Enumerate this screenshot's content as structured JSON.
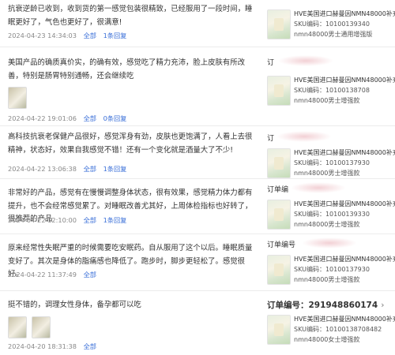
{
  "reviews": [
    {
      "text": "抗衰逆龄已收到，收到货的第一感觉包装很精致，已经服用了一段时间，睡眠更好了，气色也更好了，很满意!",
      "date": "2024-04-23 14:34:03",
      "link_all": "全部",
      "link_reply": "1条回复",
      "order_prefix": "",
      "product": {
        "title": "HVE美国进口赫曼因NMN48000补充",
        "code": "SKU编码：10100139340",
        "spec": "nmn48000男士通用增强版"
      }
    },
    {
      "text": "美国产品的确质真价实，的确有效，感觉吃了精力充沛，脸上皮肤有所改善，特别是肠胃特别通畅，还会继续吃",
      "date": "2024-04-22 19:01:06",
      "link_all": "全部",
      "link_reply": "0条回复",
      "order_prefix": "订",
      "product": {
        "title": "HVE美国进口赫曼因NMN48000补充",
        "code": "SKU编码：10100138708",
        "spec": "nmn48000男士增强款"
      }
    },
    {
      "text": "高科技抗衰老保健产品很好，感觉浑身有劲，皮肤也更饱满了，人看上去很精神，状态好，效果自我感觉不错！还有一个变化就是酒量大了不少!",
      "date": "2024-04-22 13:06:38",
      "link_all": "全部",
      "link_reply": "1条回复",
      "order_prefix": "订",
      "product": {
        "title": "HVE美国进口赫曼因NMN48000补充",
        "code": "SKU编码：10100137930",
        "spec": "nmn48000男士增强款"
      }
    },
    {
      "text": "非常好的产品，感觉有在慢慢调整身体状态，很有效果，感觉精力体力都有提升，也不会经常感觉累了。对睡眠改善尤其好，上周体检指标也好转了，很推荐的产品",
      "date": "2024-04-22 12:10:00",
      "link_all": "全部",
      "link_reply": "1条回复",
      "order_prefix": "订单编",
      "product": {
        "title": "HVE美国进口赫曼因NMN48000补充",
        "code": "SKU编码：10100139330",
        "spec": "nmn48000男士增强款"
      }
    },
    {
      "text": "原来经常性失眠严重的时候需要吃安眠药。自从服用了这个以后。睡眠质量变好了。其次是身体的脂痛感也降低了。跑步时，脚步更轻松了。感觉很好。",
      "date": "2024-04-22 11:37:49",
      "link_all": "全部",
      "link_reply": "",
      "order_prefix": "订单编号",
      "product": {
        "title": "HVE美国进口赫曼因NMN48000补充",
        "code": "SKU编码：10100137930",
        "spec": "nmn48000男士增强款"
      }
    },
    {
      "text": "挺不错的，调理女性身体，备孕都可以吃",
      "date": "2024-04-20 18:31:38",
      "link_all": "全部",
      "link_reply": "",
      "order_prefix": "订单编号：291948860174",
      "product": {
        "title": "HVE美国进口赫曼因NMN48000补充",
        "code": "SKU编码：10100138708482",
        "spec": "nmn48000女士增强款"
      }
    }
  ],
  "icons": {
    "chevron": "chevron-right-icon"
  },
  "colors": {
    "link": "#3a6fd8",
    "meta": "#888888"
  }
}
